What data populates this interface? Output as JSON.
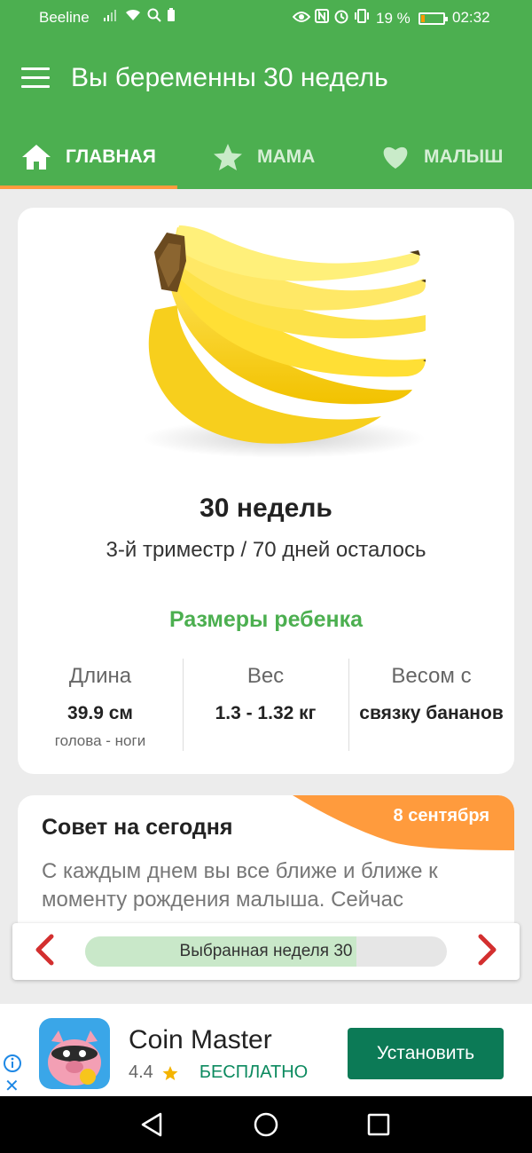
{
  "status_bar": {
    "carrier": "Beeline",
    "battery_percent": "19 %",
    "battery_level": 0.19,
    "time": "02:32"
  },
  "app_bar": {
    "title": "Вы беременны 30 недель"
  },
  "tabs": [
    {
      "label": "ГЛАВНАЯ",
      "icon": "home-icon",
      "active": true
    },
    {
      "label": "МАМА",
      "icon": "star-icon",
      "active": false
    },
    {
      "label": "МАЛЫШ",
      "icon": "heart-icon",
      "active": false
    }
  ],
  "main_card": {
    "image": "banana-bunch",
    "weeks": "30 недель",
    "trimester_info": "3-й триместр / 70 дней осталось",
    "sizes_title": "Размеры ребенка",
    "metrics": [
      {
        "label": "Длина",
        "value": "39.9 см",
        "sub": "голова - ноги"
      },
      {
        "label": "Вес",
        "value": "1.3 - 1.32 кг",
        "sub": ""
      },
      {
        "label": "Весом с",
        "value": "связку бананов",
        "sub": ""
      }
    ]
  },
  "tip_card": {
    "title": "Совет на сегодня",
    "date": "8 сентября",
    "text": "С каждым днем вы все ближе и ближе к моменту рождения малыша. Сейчас"
  },
  "week_selector": {
    "label": "Выбранная неделя 30",
    "progress": 0.75
  },
  "ad": {
    "title": "Coin Master",
    "rating": "4.4",
    "price": "БЕСПЛАТНО",
    "install_label": "Установить"
  },
  "colors": {
    "primary": "#4caf50",
    "accent": "#ff9b3d",
    "ad_button": "#0c7a56",
    "arrow_red": "#d32f2f"
  }
}
